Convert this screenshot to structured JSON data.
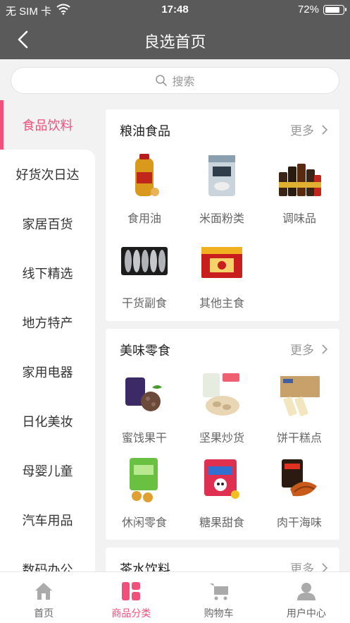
{
  "status": {
    "carrier": "无 SIM 卡",
    "time": "17:48",
    "battery": "72%"
  },
  "nav": {
    "title": "良选首页"
  },
  "search": {
    "placeholder": "搜索"
  },
  "sidebar": {
    "items": [
      {
        "label": "食品饮料"
      },
      {
        "label": "好货次日达"
      },
      {
        "label": "家居百货"
      },
      {
        "label": "线下精选"
      },
      {
        "label": "地方特产"
      },
      {
        "label": "家用电器"
      },
      {
        "label": "日化美妆"
      },
      {
        "label": "母婴儿童"
      },
      {
        "label": "汽车用品"
      },
      {
        "label": "数码办公"
      }
    ]
  },
  "sections": [
    {
      "title": "粮油食品",
      "more": "更多",
      "items": [
        {
          "label": "食用油"
        },
        {
          "label": "米面粉类"
        },
        {
          "label": "调味品"
        },
        {
          "label": "干货副食"
        },
        {
          "label": "其他主食"
        }
      ]
    },
    {
      "title": "美味零食",
      "more": "更多",
      "items": [
        {
          "label": "蜜饯果干"
        },
        {
          "label": "坚果炒货"
        },
        {
          "label": "饼干糕点"
        },
        {
          "label": "休闲零食"
        },
        {
          "label": "糖果甜食"
        },
        {
          "label": "肉干海味"
        }
      ]
    },
    {
      "title": "茶水饮料",
      "more": "更多",
      "items": []
    }
  ],
  "tabbar": {
    "items": [
      {
        "label": "首页"
      },
      {
        "label": "商品分类"
      },
      {
        "label": "购物车"
      },
      {
        "label": "用户中心"
      }
    ]
  },
  "colors": {
    "accent": "#f0507a",
    "header": "#5a5a5a"
  }
}
